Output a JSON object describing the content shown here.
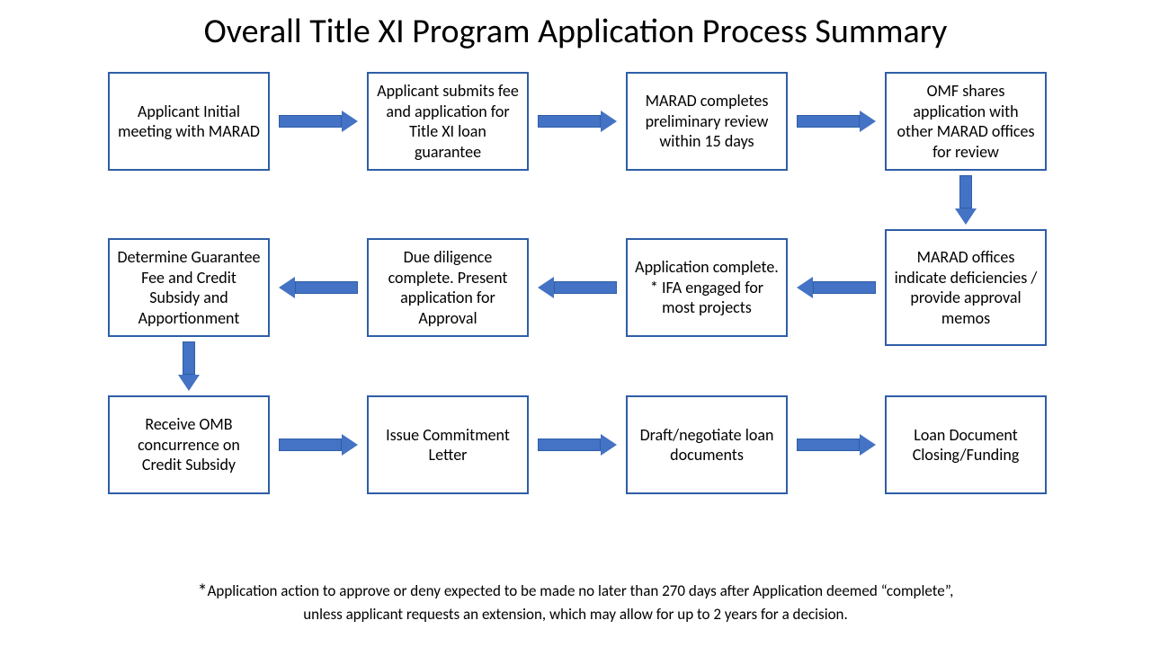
{
  "title": "Overall Title XI Program Application Process Summary",
  "boxes": {
    "b1": "Applicant Initial meeting with MARAD",
    "b2": "Applicant submits fee and application for Title XI loan guarantee",
    "b3": "MARAD completes preliminary review within 15 days",
    "b4": "OMF shares application with other MARAD offices for review",
    "b5": "MARAD offices indicate deficiencies / provide approval memos",
    "b6": "Application complete.\n* IFA engaged for most projects",
    "b7": "Due diligence complete. Present application for Approval",
    "b8": "Determine Guarantee Fee and Credit Subsidy and Apportionment",
    "b9": "Receive OMB concurrence on Credit Subsidy",
    "b10": "Issue Commitment Letter",
    "b11": "Draft/negotiate loan documents",
    "b12": "Loan Document Closing/Funding"
  },
  "footnote_line1_prefix": "*",
  "footnote_line1": "Application action to approve or deny expected to be made no later than 270 days after Application deemed “complete”,",
  "footnote_line2": "unless applicant requests an extension, which may allow for up to 2 years for a decision."
}
